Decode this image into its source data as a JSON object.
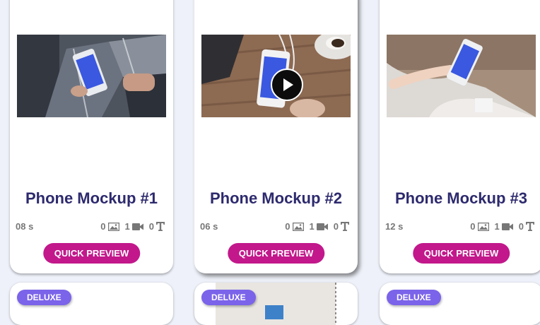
{
  "cards": [
    {
      "title": "Phone Mockup #1",
      "duration": "08 s",
      "image_count": "0",
      "video_count": "1",
      "text_count": "0",
      "preview_label": "QUICK PREVIEW",
      "image_hint": "Person in plaid pants holding phone showing 'Add your design'",
      "has_play": false
    },
    {
      "title": "Phone Mockup #2",
      "duration": "06 s",
      "image_count": "0",
      "video_count": "1",
      "text_count": "0",
      "preview_label": "QUICK PREVIEW",
      "image_hint": "Phone on wooden desk next to coffee cup and notebook",
      "has_play": true
    },
    {
      "title": "Phone Mockup #3",
      "duration": "12 s",
      "image_count": "0",
      "video_count": "1",
      "text_count": "0",
      "preview_label": "QUICK PREVIEW",
      "image_hint": "Hand holding phone at an angle in a bright room",
      "has_play": false
    }
  ],
  "next_row": [
    {
      "badge": "DELUXE"
    },
    {
      "badge": "DELUXE"
    },
    {
      "badge": "DELUXE"
    }
  ],
  "colors": {
    "title": "#2d2a6e",
    "button": "#c2188b",
    "badge": "#7b63ea",
    "page_bg": "#eef1f9"
  },
  "icons": {
    "images": "image-icon",
    "video": "video-camera-icon",
    "text": "text-icon",
    "play": "play-icon"
  }
}
